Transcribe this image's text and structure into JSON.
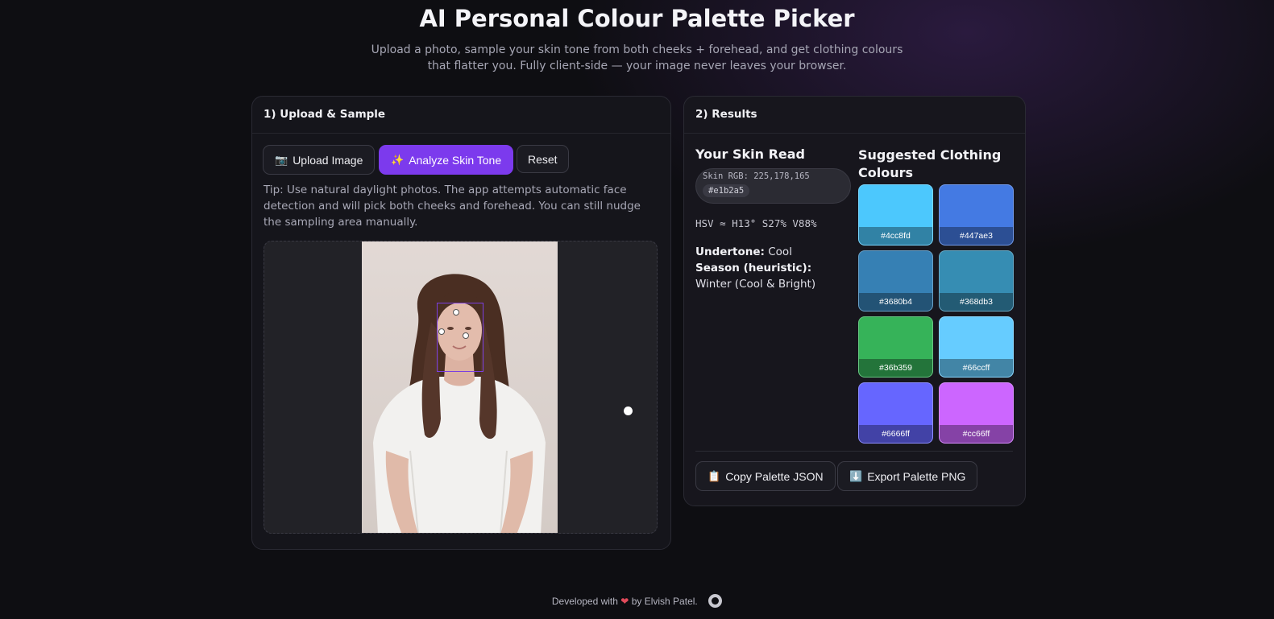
{
  "header": {
    "title": "AI Personal Colour Palette Picker",
    "subtitle": "Upload a photo, sample your skin tone from both cheeks + forehead, and get clothing colours that flatter you. Fully client-side — your image never leaves your browser."
  },
  "upload": {
    "heading": "1) Upload & Sample",
    "buttons": {
      "upload_label": "Upload Image",
      "upload_icon": "📷",
      "analyze_label": "Analyze Skin Tone",
      "analyze_icon": "✨",
      "reset_label": "Reset"
    },
    "tip": "Tip: Use natural daylight photos. The app attempts automatic face detection and will pick both cheeks and forehead. You can still nudge the sampling area manually."
  },
  "results": {
    "heading": "2) Results",
    "skin_read": {
      "title": "Your Skin Read",
      "rgb_text": "Skin RGB: 225,178,165",
      "hex": "#e1b2a5",
      "hsv_text": "HSV ≈ H13° S27% V88%",
      "undertone_label": "Undertone:",
      "undertone_value": "Cool",
      "season_label": "Season (heuristic):",
      "season_value": "Winter (Cool & Bright)"
    },
    "suggested": {
      "title": "Suggested Clothing Colours",
      "swatches": [
        {
          "hex": "#4cc8fd"
        },
        {
          "hex": "#447ae3"
        },
        {
          "hex": "#3680b4"
        },
        {
          "hex": "#368db3"
        },
        {
          "hex": "#36b359"
        },
        {
          "hex": "#66ccff"
        },
        {
          "hex": "#6666ff"
        },
        {
          "hex": "#cc66ff"
        }
      ]
    },
    "actions": {
      "copy_label": "Copy Palette JSON",
      "copy_icon": "📋",
      "export_label": "Export Palette PNG",
      "export_icon": "⬇️"
    }
  },
  "footer": {
    "prefix": "Developed with",
    "heart": "❤",
    "suffix": "by Elvish Patel."
  },
  "colors": {
    "accent": "#7c3aed",
    "background": "#0e0e12",
    "card": "#15151b",
    "skin": "#e1b2a5"
  }
}
